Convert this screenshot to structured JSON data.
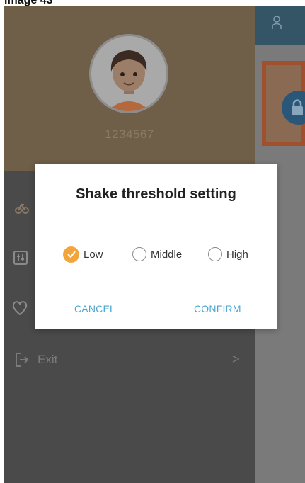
{
  "caption": {
    "text": "Image 43"
  },
  "profile": {
    "user_id": "1234567"
  },
  "menu": {
    "exit_label": "Exit",
    "exit_chevron": ">"
  },
  "dialog": {
    "title": "Shake threshold setting",
    "options": [
      {
        "label": "Low",
        "selected": true
      },
      {
        "label": "Middle",
        "selected": false
      },
      {
        "label": "High",
        "selected": false
      }
    ],
    "cancel_label": "CANCEL",
    "confirm_label": "CONFIRM"
  },
  "colors": {
    "accent_orange": "#f2a53b",
    "button_blue": "#4ba6cf"
  },
  "icons": [
    "user-icon",
    "lock-icon",
    "bike-icon",
    "settings-icon",
    "heart-icon",
    "exit-icon",
    "chevron-right-icon",
    "check-icon"
  ]
}
